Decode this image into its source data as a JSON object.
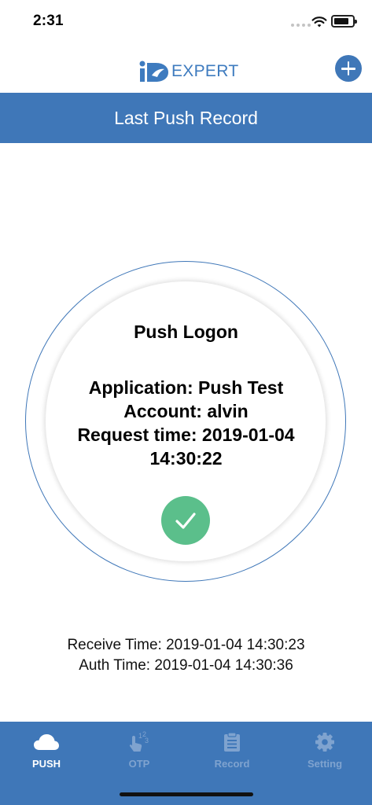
{
  "status_bar": {
    "time": "2:31"
  },
  "nav": {
    "logo_text": "EXPERT"
  },
  "header": {
    "title": "Last Push Record"
  },
  "record": {
    "type": "Push Logon",
    "application": "Application: Push Test",
    "account": "Account: alvin",
    "request_time": "Request time: 2019-01-04 14:30:22"
  },
  "times": {
    "receive": "Receive Time: 2019-01-04 14:30:23",
    "auth": "Auth Time: 2019-01-04 14:30:36"
  },
  "tabs": [
    {
      "label": "PUSH",
      "icon": "cloud-icon",
      "active": true
    },
    {
      "label": "OTP",
      "icon": "touch-otp-icon",
      "active": false
    },
    {
      "label": "Record",
      "icon": "clipboard-icon",
      "active": false
    },
    {
      "label": "Setting",
      "icon": "gear-icon",
      "active": false
    }
  ],
  "colors": {
    "primary": "#3f77b8",
    "success": "#5bbf8b",
    "tab_inactive": "#7fa3cf"
  }
}
